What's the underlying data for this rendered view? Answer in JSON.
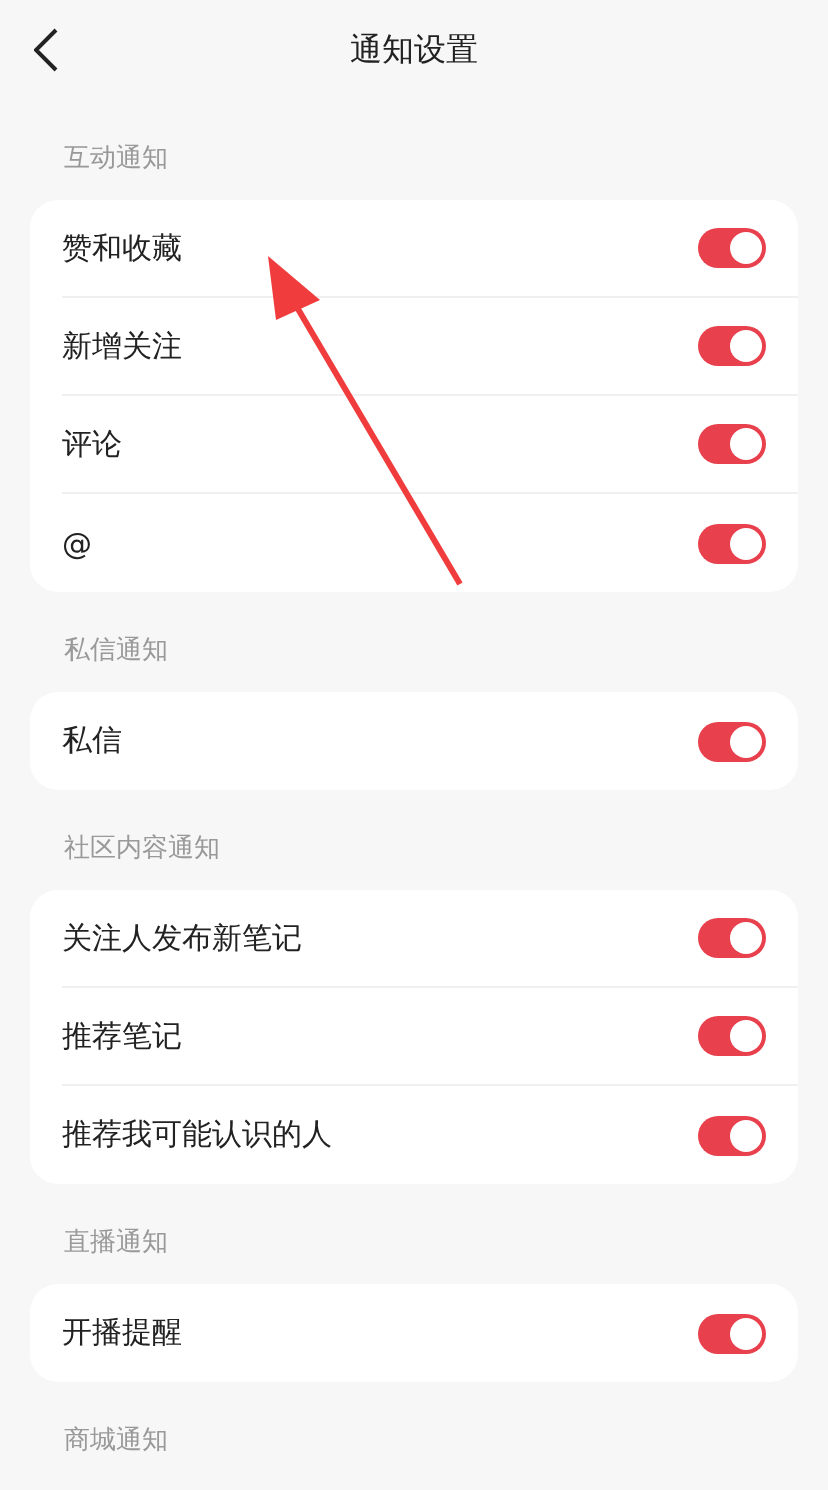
{
  "header": {
    "title": "通知设置"
  },
  "sections": [
    {
      "label": "互动通知",
      "items": [
        {
          "label": "赞和收藏",
          "on": true
        },
        {
          "label": "新增关注",
          "on": true
        },
        {
          "label": "评论",
          "on": true
        },
        {
          "label": "@",
          "on": true
        }
      ]
    },
    {
      "label": "私信通知",
      "items": [
        {
          "label": "私信",
          "on": true
        }
      ]
    },
    {
      "label": "社区内容通知",
      "items": [
        {
          "label": "关注人发布新笔记",
          "on": true
        },
        {
          "label": "推荐笔记",
          "on": true
        },
        {
          "label": "推荐我可能认识的人",
          "on": true
        }
      ]
    },
    {
      "label": "直播通知",
      "items": [
        {
          "label": "开播提醒",
          "on": true
        }
      ]
    },
    {
      "label": "商城通知"
    }
  ]
}
